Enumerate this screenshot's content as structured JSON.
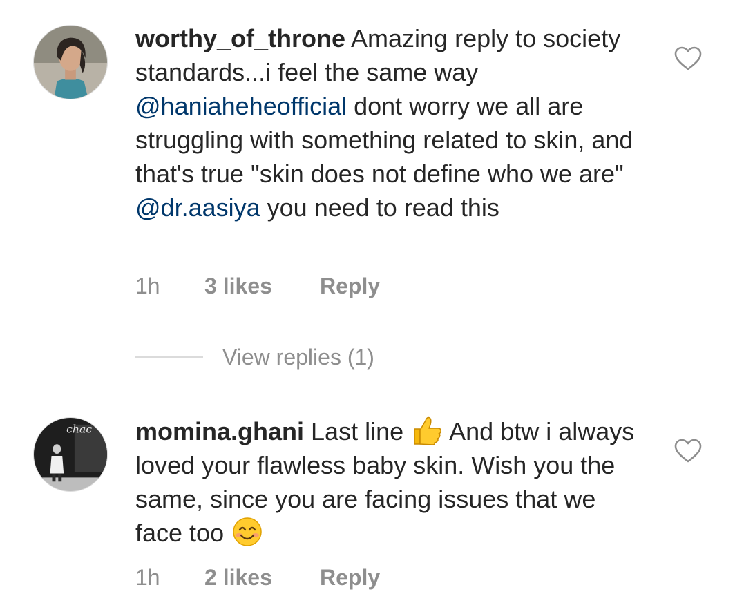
{
  "comments": [
    {
      "username": "worthy_of_throne",
      "segments": [
        {
          "type": "text",
          "value": " Amazing reply to society standards...i feel the same way "
        },
        {
          "type": "mention",
          "value": "@haniaheheofficial"
        },
        {
          "type": "text",
          "value": "  dont worry we all are struggling with something related to skin, and that's true \"skin does not define who we are\" "
        },
        {
          "type": "mention",
          "value": "@dr.aasiya"
        },
        {
          "type": "text",
          "value": " you need to read this"
        }
      ],
      "time": "1h",
      "likes": "3 likes",
      "reply_label": "Reply",
      "view_replies": "View replies (1)",
      "avatar_icon": "profile-photo-woman",
      "like_icon": "heart-outline-icon"
    },
    {
      "username": "momina.ghani",
      "segments": [
        {
          "type": "text",
          "value": " Last line "
        },
        {
          "type": "emoji",
          "value": "thumbs-up"
        },
        {
          "type": "text",
          "value": " And btw i always loved your flawless baby skin. Wish you the same, since you are facing issues that we face too "
        },
        {
          "type": "emoji",
          "value": "smiling-face"
        }
      ],
      "time": "1h",
      "likes": "2 likes",
      "reply_label": "Reply",
      "avatar_icon": "profile-photo-grayscale",
      "like_icon": "heart-outline-icon"
    }
  ],
  "colors": {
    "text": "#262626",
    "mention": "#00376b",
    "meta": "#8e8e8e",
    "divider": "#dbdbdb"
  }
}
